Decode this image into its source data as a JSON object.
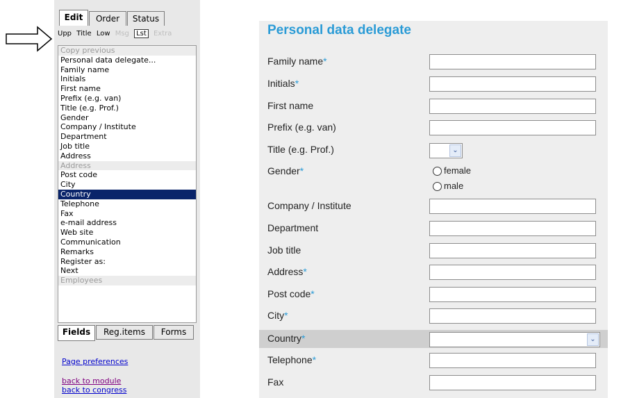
{
  "left_panel": {
    "top_tabs": [
      "Edit",
      "Order",
      "Status"
    ],
    "tools": [
      "Upp",
      "Title",
      "Low",
      "Msg",
      "Lst",
      "Extra"
    ],
    "items": [
      {
        "label": "Copy previous",
        "state": "disabled"
      },
      {
        "label": "Personal data delegate...",
        "state": "normal"
      },
      {
        "label": "Family name",
        "state": "normal"
      },
      {
        "label": "Initials",
        "state": "normal"
      },
      {
        "label": "First name",
        "state": "normal"
      },
      {
        "label": "Prefix (e.g. van)",
        "state": "normal"
      },
      {
        "label": "Title (e.g. Prof.)",
        "state": "normal"
      },
      {
        "label": "Gender",
        "state": "normal"
      },
      {
        "label": "Company / Institute",
        "state": "normal"
      },
      {
        "label": "Department",
        "state": "normal"
      },
      {
        "label": "Job title",
        "state": "normal"
      },
      {
        "label": "Address",
        "state": "normal"
      },
      {
        "label": "Address",
        "state": "disabled"
      },
      {
        "label": "Post code",
        "state": "normal"
      },
      {
        "label": "City",
        "state": "normal"
      },
      {
        "label": "Country",
        "state": "selected"
      },
      {
        "label": "Telephone",
        "state": "normal"
      },
      {
        "label": "Fax",
        "state": "normal"
      },
      {
        "label": "e-mail address",
        "state": "normal"
      },
      {
        "label": "Web site",
        "state": "normal"
      },
      {
        "label": "Communication",
        "state": "normal"
      },
      {
        "label": "Remarks",
        "state": "normal"
      },
      {
        "label": "Register as:",
        "state": "normal"
      },
      {
        "label": "Next",
        "state": "normal"
      },
      {
        "label": "Employees",
        "state": "disabled"
      }
    ],
    "bottom_tabs": [
      "Fields",
      "Reg.items",
      "Forms"
    ],
    "links": {
      "page_preferences": "Page preferences",
      "back_to_module": "back to module",
      "back_to_congress": "back to congress"
    }
  },
  "form": {
    "title": "Personal data delegate",
    "required_marker": "*",
    "fields": [
      {
        "label": "Family name",
        "required": true,
        "type": "text"
      },
      {
        "label": "Initials",
        "required": true,
        "type": "text"
      },
      {
        "label": "First name",
        "required": false,
        "type": "text"
      },
      {
        "label": "Prefix (e.g. van)",
        "required": false,
        "type": "text"
      },
      {
        "label": "Title (e.g. Prof.)",
        "required": false,
        "type": "select-small"
      },
      {
        "label": "Gender",
        "required": true,
        "type": "radio",
        "options": [
          "female",
          "male"
        ]
      },
      {
        "label": "Company / Institute",
        "required": false,
        "type": "text"
      },
      {
        "label": "Department",
        "required": false,
        "type": "text"
      },
      {
        "label": "Job title",
        "required": false,
        "type": "text"
      },
      {
        "label": "Address",
        "required": true,
        "type": "text"
      },
      {
        "label": "Post code",
        "required": true,
        "type": "text"
      },
      {
        "label": "City",
        "required": true,
        "type": "text"
      },
      {
        "label": "Country",
        "required": true,
        "type": "select-wide"
      },
      {
        "label": "Telephone",
        "required": true,
        "type": "text"
      },
      {
        "label": "Fax",
        "required": false,
        "type": "text"
      }
    ]
  },
  "colors": {
    "accent": "#2a9bd6",
    "selection": "#0a246a",
    "panel_bg": "#e8e8e8",
    "form_bg": "#eeeeee"
  }
}
